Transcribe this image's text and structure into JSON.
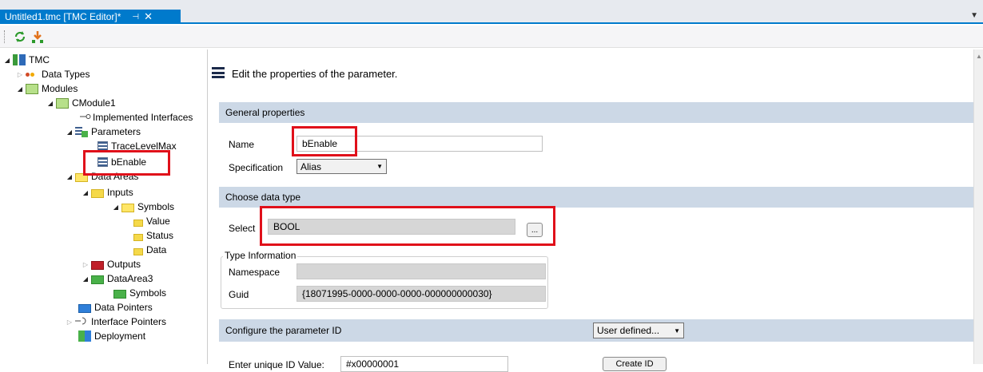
{
  "tab": {
    "title": "Untitled1.tmc [TMC Editor]*",
    "pin": "⊣",
    "close": "✕"
  },
  "toolbar": {
    "refresh_icon": "refresh-icon",
    "merge_icon": "merge-icon"
  },
  "tree": {
    "root": "TMC",
    "data_types": "Data Types",
    "modules": "Modules",
    "cmodule": "CModule1",
    "implemented": "Implemented Interfaces",
    "parameters": "Parameters",
    "trace": "TraceLevelMax",
    "benable": "bEnable",
    "data_areas": "Data Areas",
    "inputs": "Inputs",
    "symbols": "Symbols",
    "value": "Value",
    "status": "Status",
    "data": "Data",
    "outputs": "Outputs",
    "dataarea3": "DataArea3",
    "symbols2": "Symbols",
    "data_pointers": "Data Pointers",
    "interface_pointers": "Interface Pointers",
    "deployment": "Deployment"
  },
  "panel": {
    "header": "Edit the properties of the parameter.",
    "general": "General properties",
    "name_label": "Name",
    "name_value": "bEnable",
    "spec_label": "Specification",
    "spec_value": "Alias",
    "choose": "Choose data type",
    "select_label": "Select",
    "select_value": "BOOL",
    "browse": "...",
    "typeinfo": "Type Information",
    "ns_label": "Namespace",
    "ns_value": "",
    "guid_label": "Guid",
    "guid_value": "{18071995-0000-0000-0000-000000000030}",
    "configure": "Configure the parameter ID",
    "user_defined": "User defined...",
    "enter_label": "Enter unique ID Value:",
    "id_value": "#x00000001",
    "create_id": "Create ID"
  },
  "colors": {
    "accent": "#007acc",
    "highlight": "#e0101a",
    "section": "#ccd8e6"
  }
}
